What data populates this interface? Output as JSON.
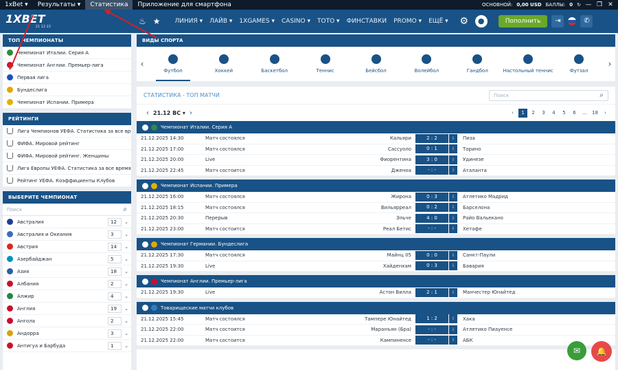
{
  "topbar": {
    "items": [
      "1xBet",
      "Результаты",
      "Статистика",
      "Приложение для смартфона"
    ],
    "active": "Статистика",
    "balance_label": "ОСНОВНОЙ:",
    "balance_value": "0,00 USD",
    "points_label": "БАЛЛЫ:",
    "points_value": "0"
  },
  "logo": {
    "text": "1XBET",
    "sub": "21 12 22"
  },
  "nav": [
    "ЛИНИЯ",
    "ЛАЙВ",
    "1XGAMES",
    "CASINO",
    "ТОТО",
    "ФИНСТАВКИ",
    "PROMO",
    "ЕЩЁ"
  ],
  "deposit_label": "Пополнить",
  "sidebar": {
    "top_title": "ТОП ЧЕМПИОНАТЫ",
    "top": [
      {
        "label": "Чемпионат Италии. Серия А",
        "color": "#2e8b3a"
      },
      {
        "label": "Чемпионат Англии. Премьер-лига",
        "color": "#c8102e"
      },
      {
        "label": "Первая лига",
        "color": "#1c4fbf"
      },
      {
        "label": "Бундеслига",
        "color": "#e0a800"
      },
      {
        "label": "Чемпионат Испании. Примера",
        "color": "#e2b100"
      }
    ],
    "ratings_title": "РЕЙТИНГИ",
    "ratings": [
      "Лига Чемпионов УЕФА. Статистика за все время",
      "ФИФА. Мировой рейтинг",
      "ФИФА. Мировой рейтинг. Женщины",
      "Лига Европы УЕФА. Статистика за все время",
      "Рейтинг УЕФА. Коэффициенты Клубов"
    ],
    "choose_title": "ВЫБЕРИТЕ ЧЕМПИОНАТ",
    "search_placeholder": "Поиск",
    "countries": [
      {
        "name": "Австралия",
        "count": "12",
        "color": "#1c3f94"
      },
      {
        "name": "Австралия и Океания",
        "count": "3",
        "color": "#3a6dc0"
      },
      {
        "name": "Австрия",
        "count": "14",
        "color": "#d52b1e"
      },
      {
        "name": "Азербайджан",
        "count": "5",
        "color": "#0092bc"
      },
      {
        "name": "Азия",
        "count": "18",
        "color": "#2a5ea8"
      },
      {
        "name": "Албания",
        "count": "2",
        "color": "#c8102e"
      },
      {
        "name": "Алжир",
        "count": "4",
        "color": "#1e8a3e"
      },
      {
        "name": "Англия",
        "count": "19",
        "color": "#c8102e"
      },
      {
        "name": "Ангола",
        "count": "2",
        "color": "#cc092f"
      },
      {
        "name": "Андорра",
        "count": "3",
        "color": "#d9a600"
      },
      {
        "name": "Антигуа и Барбуда",
        "count": "1",
        "color": "#ce1126"
      }
    ]
  },
  "sports": {
    "title": "ВИДЫ СПОРТА",
    "items": [
      "Футбол",
      "Хоккей",
      "Баскетбол",
      "Теннис",
      "Бейсбол",
      "Волейбол",
      "Гандбол",
      "Настольный теннис",
      "Футзал"
    ]
  },
  "stats": {
    "title": "СТАТИСТИКА - ТОП МАТЧИ",
    "search_placeholder": "Поиск",
    "date": "21.12 ВС",
    "pages": [
      "1",
      "2",
      "3",
      "4",
      "5",
      "6",
      "...",
      "18"
    ]
  },
  "leagues": [
    {
      "name": "Чемпионат Италии. Серия А",
      "color": "#2e8b3a",
      "matches": [
        {
          "time": "21.12.2025 14:30",
          "status": "Матч состоялся",
          "home": "Кальяри",
          "score": "2 : 2",
          "away": "Пиза"
        },
        {
          "time": "21.12.2025 17:00",
          "status": "Матч состоялся",
          "home": "Сассуоло",
          "score": "0 : 1",
          "away": "Торино"
        },
        {
          "time": "21.12.2025 20:00",
          "status": "Live",
          "home": "Фиорентина",
          "score": "3 : 0",
          "away": "Удинезе"
        },
        {
          "time": "21.12.2025 22:45",
          "status": "Матч состоится",
          "home": "Дженоа",
          "score": "- : -",
          "away": "Аталанта"
        }
      ]
    },
    {
      "name": "Чемпионат Испании. Примера",
      "color": "#e2b100",
      "matches": [
        {
          "time": "21.12.2025 16:00",
          "status": "Матч состоялся",
          "home": "Жирона",
          "score": "0 : 3",
          "away": "Атлетико Мадрид"
        },
        {
          "time": "21.12.2025 18:15",
          "status": "Матч состоялся",
          "home": "Вильярреал",
          "score": "0 : 2",
          "away": "Барселона"
        },
        {
          "time": "21.12.2025 20:30",
          "status": "Перерыв",
          "home": "Эльче",
          "score": "4 : 0",
          "away": "Райо Вальекано"
        },
        {
          "time": "21.12.2025 23:00",
          "status": "Матч состоится",
          "home": "Реал Бетис",
          "score": "- : -",
          "away": "Хетафе"
        }
      ]
    },
    {
      "name": "Чемпионат Германии. Бундеслига",
      "color": "#e0a800",
      "matches": [
        {
          "time": "21.12.2025 17:30",
          "status": "Матч состоялся",
          "home": "Майнц 05",
          "score": "0 : 0",
          "away": "Санкт-Паули"
        },
        {
          "time": "21.12.2025 19:30",
          "status": "Live",
          "home": "Хайденхам",
          "score": "0 : 3",
          "away": "Бавария"
        }
      ]
    },
    {
      "name": "Чемпионат Англии. Премьер-лига",
      "color": "#c8102e",
      "matches": [
        {
          "time": "21.12.2025 19:30",
          "status": "Live",
          "home": "Астон Вилла",
          "score": "2 : 1",
          "away": "Манчестер Юнайтед"
        }
      ]
    },
    {
      "name": "Товарищеские матчи клубов",
      "color": "#2a7fbf",
      "matches": [
        {
          "time": "21.12.2025 15:45",
          "status": "Матч состоялся",
          "home": "Тампере Юнайтед",
          "score": "1 : 2",
          "away": "Хака"
        },
        {
          "time": "21.12.2025 22:00",
          "status": "Матч состоится",
          "home": "Маранъян (Бра)",
          "score": "- : -",
          "away": "Атлетико Пиауенсе"
        },
        {
          "time": "21.12.2025 22:00",
          "status": "Матч состоится",
          "home": "Кампиненсе",
          "score": "- : -",
          "away": "АБК"
        }
      ]
    }
  ]
}
